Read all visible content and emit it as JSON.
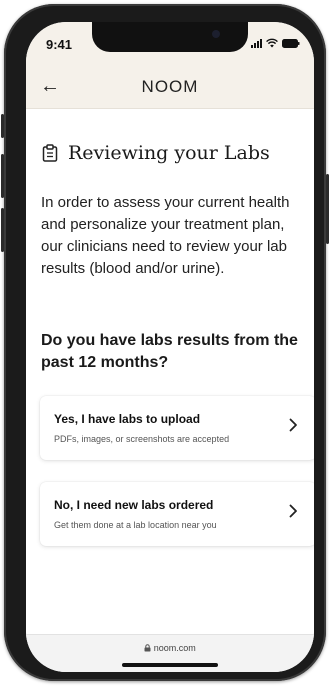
{
  "status_bar": {
    "time": "9:41"
  },
  "header": {
    "back_label": "←",
    "brand": "NOOM"
  },
  "main": {
    "title": "Reviewing your Labs",
    "intro": "In order to assess your current health and personalize your treatment plan, our clinicians need to review your lab results (blood and/or urine).",
    "question": "Do you have labs results from the past 12 months?",
    "options": [
      {
        "title": "Yes, I have labs to upload",
        "subtitle": "PDFs, images, or screenshots are accepted"
      },
      {
        "title": "No, I need new labs ordered",
        "subtitle": "Get them done at a lab location near you"
      }
    ]
  },
  "browser": {
    "url": "noom.com"
  },
  "icons": {
    "heading": "clipboard-icon",
    "option_chevron": "chevron-right-icon",
    "url_lock": "lock-icon"
  }
}
